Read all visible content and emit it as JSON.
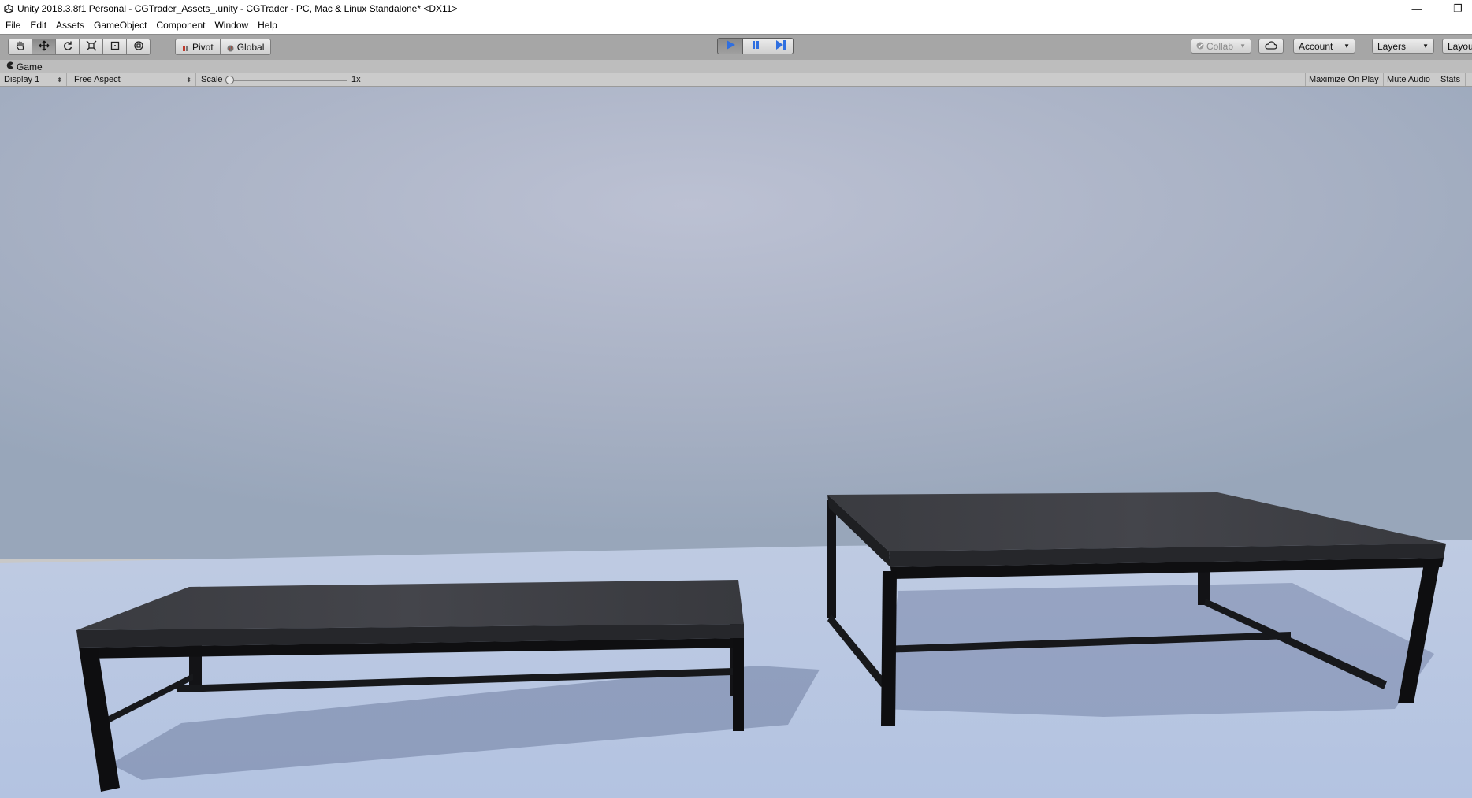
{
  "window": {
    "title": "Unity 2018.3.8f1 Personal - CGTrader_Assets_.unity - CGTrader - PC, Mac & Linux Standalone* <DX11>",
    "minimize_glyph": "—",
    "maximize_glyph": "❐"
  },
  "menu": {
    "items": [
      "File",
      "Edit",
      "Assets",
      "GameObject",
      "Component",
      "Window",
      "Help"
    ]
  },
  "toolbar": {
    "tools": [
      {
        "icon": "hand-icon"
      },
      {
        "icon": "move-icon"
      },
      {
        "icon": "rotate-icon"
      },
      {
        "icon": "scale-icon"
      },
      {
        "icon": "rect-tool-icon"
      },
      {
        "icon": "transform-icon"
      }
    ],
    "pivot_label": "Pivot",
    "global_label": "Global",
    "collab_label": "Collab",
    "account_label": "Account",
    "layers_label": "Layers",
    "layout_label": "Layou",
    "play_state": "playing",
    "accent_color": "#2f6fe0"
  },
  "game_tab": {
    "label": "Game"
  },
  "game_bar": {
    "display_label": "Display 1",
    "aspect_label": "Free Aspect",
    "scale_label": "Scale",
    "scale_value": "1x",
    "maximize_label": "Maximize On Play",
    "mute_label": "Mute Audio",
    "stats_label": "Stats"
  }
}
